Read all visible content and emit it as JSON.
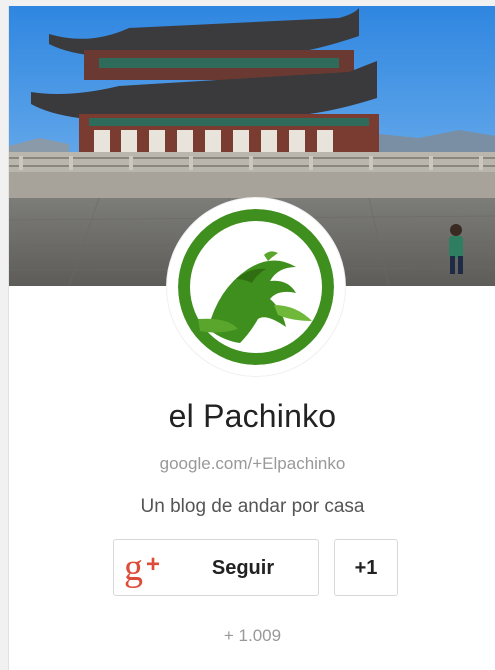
{
  "profile": {
    "name": "el Pachinko",
    "handle": "google.com/+Elpachinko",
    "tagline": "Un blog de andar por casa",
    "follower_count": "+ 1.009"
  },
  "actions": {
    "follow_label": "Seguir",
    "follow_icon": "google-plus-icon",
    "plusone_label": "+1"
  },
  "colors": {
    "gplus_red": "#dd4b39",
    "logo_green": "#3f8f1e",
    "button_border": "#d8d8d8"
  }
}
